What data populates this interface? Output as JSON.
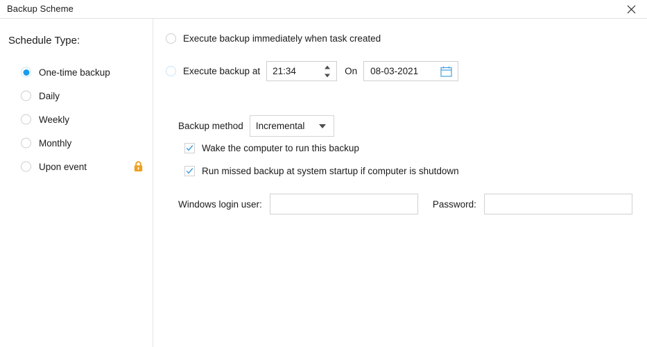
{
  "window": {
    "title": "Backup Scheme",
    "close_icon": "close-icon"
  },
  "sidebar": {
    "heading": "Schedule Type:",
    "items": [
      {
        "label": "One-time backup",
        "selected": true,
        "locked": false
      },
      {
        "label": "Daily",
        "selected": false,
        "locked": false
      },
      {
        "label": "Weekly",
        "selected": false,
        "locked": false
      },
      {
        "label": "Monthly",
        "selected": false,
        "locked": false
      },
      {
        "label": "Upon event",
        "selected": false,
        "locked": true
      }
    ],
    "lock_icon": "lock-icon"
  },
  "main": {
    "schedule_options": [
      {
        "label": "Execute backup immediately when task created",
        "selected": false
      },
      {
        "label": "Execute backup at",
        "selected": true
      }
    ],
    "time": {
      "value": "21:34",
      "spinner_up_icon": "caret-up-icon",
      "spinner_down_icon": "caret-down-icon"
    },
    "on_label": "On",
    "date": {
      "value": "08-03-2021",
      "calendar_icon": "calendar-icon"
    },
    "backup_method": {
      "label": "Backup method",
      "value": "Incremental",
      "dropdown_icon": "chevron-down-icon"
    },
    "checkboxes": [
      {
        "label": "Wake the computer to run this backup",
        "checked": true
      },
      {
        "label": "Run missed backup at system startup if computer is shutdown",
        "checked": true
      }
    ],
    "credentials": {
      "user_label": "Windows login user:",
      "user_value": "",
      "password_label": "Password:",
      "password_value": ""
    }
  },
  "colors": {
    "accent": "#1a9ced",
    "lock": "#f0a020",
    "border": "#d0d0d0",
    "text": "#1a1a1a"
  }
}
